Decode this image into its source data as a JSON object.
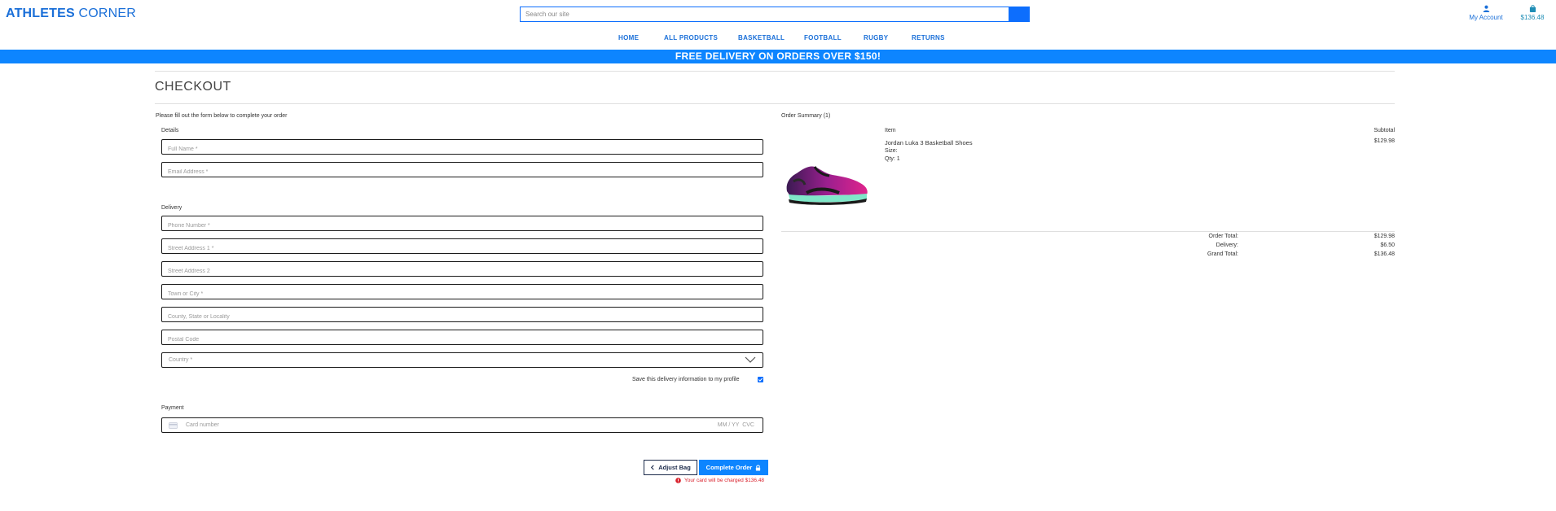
{
  "brand": {
    "part1": "ATHLETES",
    "part2": "CORNER"
  },
  "search": {
    "placeholder": "Search our site"
  },
  "account": {
    "label": "My Account"
  },
  "bag": {
    "total": "$136.48"
  },
  "nav": [
    "HOME",
    "ALL PRODUCTS",
    "BASKETBALL",
    "FOOTBALL",
    "RUGBY",
    "RETURNS"
  ],
  "banner": "FREE DELIVERY ON ORDERS OVER $150!",
  "page_title": "CHECKOUT",
  "form": {
    "intro": "Please fill out the form below to complete your order",
    "details_legend": "Details",
    "full_name": "Full Name *",
    "email": "Email Address *",
    "delivery_legend": "Delivery",
    "phone": "Phone Number *",
    "street1": "Street Address 1 *",
    "street2": "Street Address 2",
    "town": "Town or City *",
    "county": "County, State or Locality",
    "postcode": "Postal Code",
    "country": "Country *",
    "save_info": "Save this delivery information to my profile",
    "save_checked": true,
    "payment_legend": "Payment",
    "card_placeholder": "Card number",
    "card_expiry_cvc": "MM / YY  CVC"
  },
  "actions": {
    "adjust": "Adjust Bag",
    "complete": "Complete Order",
    "charge_notice": "Your card will be charged $136.48"
  },
  "summary": {
    "heading": "Order Summary (1)",
    "col_item": "Item",
    "col_subtotal": "Subtotal",
    "product": {
      "name": "Jordan Luka 3 Basketball Shoes",
      "size": "Size:",
      "qty": "Qty: 1",
      "subtotal": "$129.98"
    },
    "order_total_label": "Order Total:",
    "order_total": "$129.98",
    "delivery_label": "Delivery:",
    "delivery": "$6.50",
    "grand_total_label": "Grand Total:",
    "grand_total": "$136.48"
  },
  "colors": {
    "accent": "#0d85ff",
    "brand": "#1a6fd8",
    "error": "#d9232e"
  }
}
